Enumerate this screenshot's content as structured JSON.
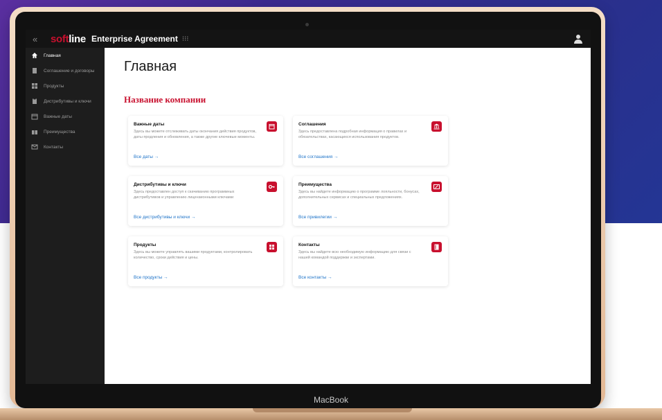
{
  "device": {
    "label": "MacBook"
  },
  "topbar": {
    "collapse_icon": "«",
    "logo_part1": "soft",
    "logo_part2": "line",
    "app_title": "Enterprise Agreement",
    "grid_icon": "⁝⁝⁝"
  },
  "sidebar": {
    "items": [
      {
        "label": "Главная",
        "icon": "home-icon"
      },
      {
        "label": "Соглашение и договоры",
        "icon": "document-icon"
      },
      {
        "label": "Продукты",
        "icon": "grid-icon"
      },
      {
        "label": "Дистрибутивы и ключи",
        "icon": "clipboard-icon"
      },
      {
        "label": "Важные даты",
        "icon": "calendar-icon"
      },
      {
        "label": "Преимущества",
        "icon": "gift-icon"
      },
      {
        "label": "Контакты",
        "icon": "mail-icon"
      }
    ]
  },
  "main": {
    "title": "Главная",
    "company": "Название компании",
    "cards": [
      {
        "title": "Важные даты",
        "desc": "Здесь вы можете отслеживать даты окончания действия продуктов, даты продления и обновления, а также другие ключевые моменты.",
        "link": "Все даты →",
        "icon": "calendar-icon"
      },
      {
        "title": "Соглашения",
        "desc": "Здесь предоставлена подробная информация о правилах и обязательствах, касающихся использования продуктов.",
        "link": "Все соглашения →",
        "icon": "bank-icon"
      },
      {
        "title": "Дистрибутивы и ключи",
        "desc": "Здесь предоставлен доступ к скачиванию программных дистрибутивов и управлению лицензионными ключами",
        "link": "Все дистрибутивы и ключи →",
        "icon": "key-icon"
      },
      {
        "title": "Преимущества",
        "desc": "Здесь вы найдете информацию о программе лояльности, бонусах, дополнительных сервисах и специальных предложениях.",
        "link": "Все привилегии →",
        "icon": "ticket-icon"
      },
      {
        "title": "Продукты",
        "desc": "Здесь вы можете управлять вашими продуктами, контролировать количество, сроки действия и цены.",
        "link": "Все продукты →",
        "icon": "grid-icon"
      },
      {
        "title": "Контакты",
        "desc": "Здесь вы найдете всю необходимую информацию для связи с нашей командой поддержки и экспертами.",
        "link": "Все контакты →",
        "icon": "book-icon"
      }
    ]
  },
  "colors": {
    "accent": "#c8102e",
    "link": "#1e73c8",
    "sidebar": "#1d1d1d",
    "topbar": "#141414"
  }
}
